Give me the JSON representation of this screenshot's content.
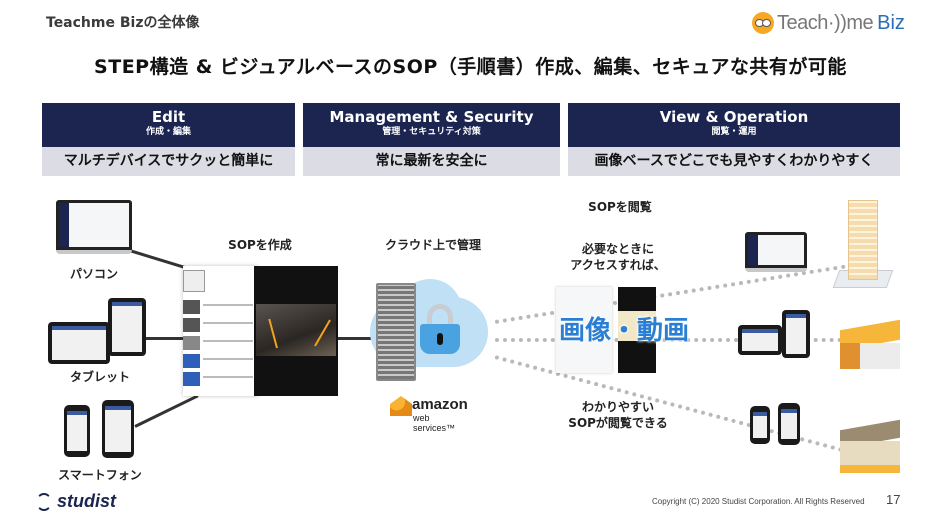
{
  "slide": {
    "section_label": "Teachme Bizの全体像",
    "headline": "STEP構造 & ビジュアルベースのSOP（手順書）作成、編集、セキュアな共有が可能",
    "brand": {
      "logo_icon": "owl-mascot-icon",
      "name_part1": "Teach·))me",
      "name_part2": "Biz",
      "accent_color": "#2a6fb5",
      "mascot_color": "#f7a823"
    }
  },
  "pillars": [
    {
      "title": "Edit",
      "subtitle": "作成・編集",
      "description": "マルチデバイスでサクッと簡単に"
    },
    {
      "title": "Management & Security",
      "subtitle": "管理・セキュリティ対策",
      "description": "常に最新を安全に"
    },
    {
      "title": "View & Operation",
      "subtitle": "閲覧・運用",
      "description": "画像ベースでどこでも見やすくわかりやすく"
    }
  ],
  "pillar_colors": {
    "header_bg": "#1b2550",
    "desc_bg": "#dcdde4"
  },
  "edit_devices": [
    {
      "label": "パソコン",
      "icon": "laptop-icon"
    },
    {
      "label": "タブレット",
      "icon": "tablet-icon"
    },
    {
      "label": "スマートフォン",
      "icon": "smartphone-icon"
    }
  ],
  "create": {
    "label": "SOPを作成"
  },
  "manage": {
    "label": "クラウド上で管理",
    "server_icon": "server-rack-icon",
    "cloud_icon": "cloud-icon",
    "lock_icon": "padlock-icon",
    "provider": {
      "name": "amazon",
      "sub": "web services™",
      "icon": "aws-cubes-icon"
    }
  },
  "view": {
    "label": "SOPを閲覧",
    "access_text_line1": "必要なときに",
    "access_text_line2": "アクセスすれば、",
    "media_label": "画像・動画",
    "result_line1": "わかりやすい",
    "result_line2": "SOPが閲覧できる",
    "locations": [
      {
        "icon": "office-building-icon",
        "device": "laptop-icon"
      },
      {
        "icon": "warehouse-icon",
        "device": "tablet-icon"
      },
      {
        "icon": "store-icon",
        "device": "smartphone-icon"
      }
    ]
  },
  "footer": {
    "company_logo": "studist",
    "copyright": "Copyright (C) 2020 Studist Corporation. All Rights Reserved",
    "page_number": "17"
  }
}
